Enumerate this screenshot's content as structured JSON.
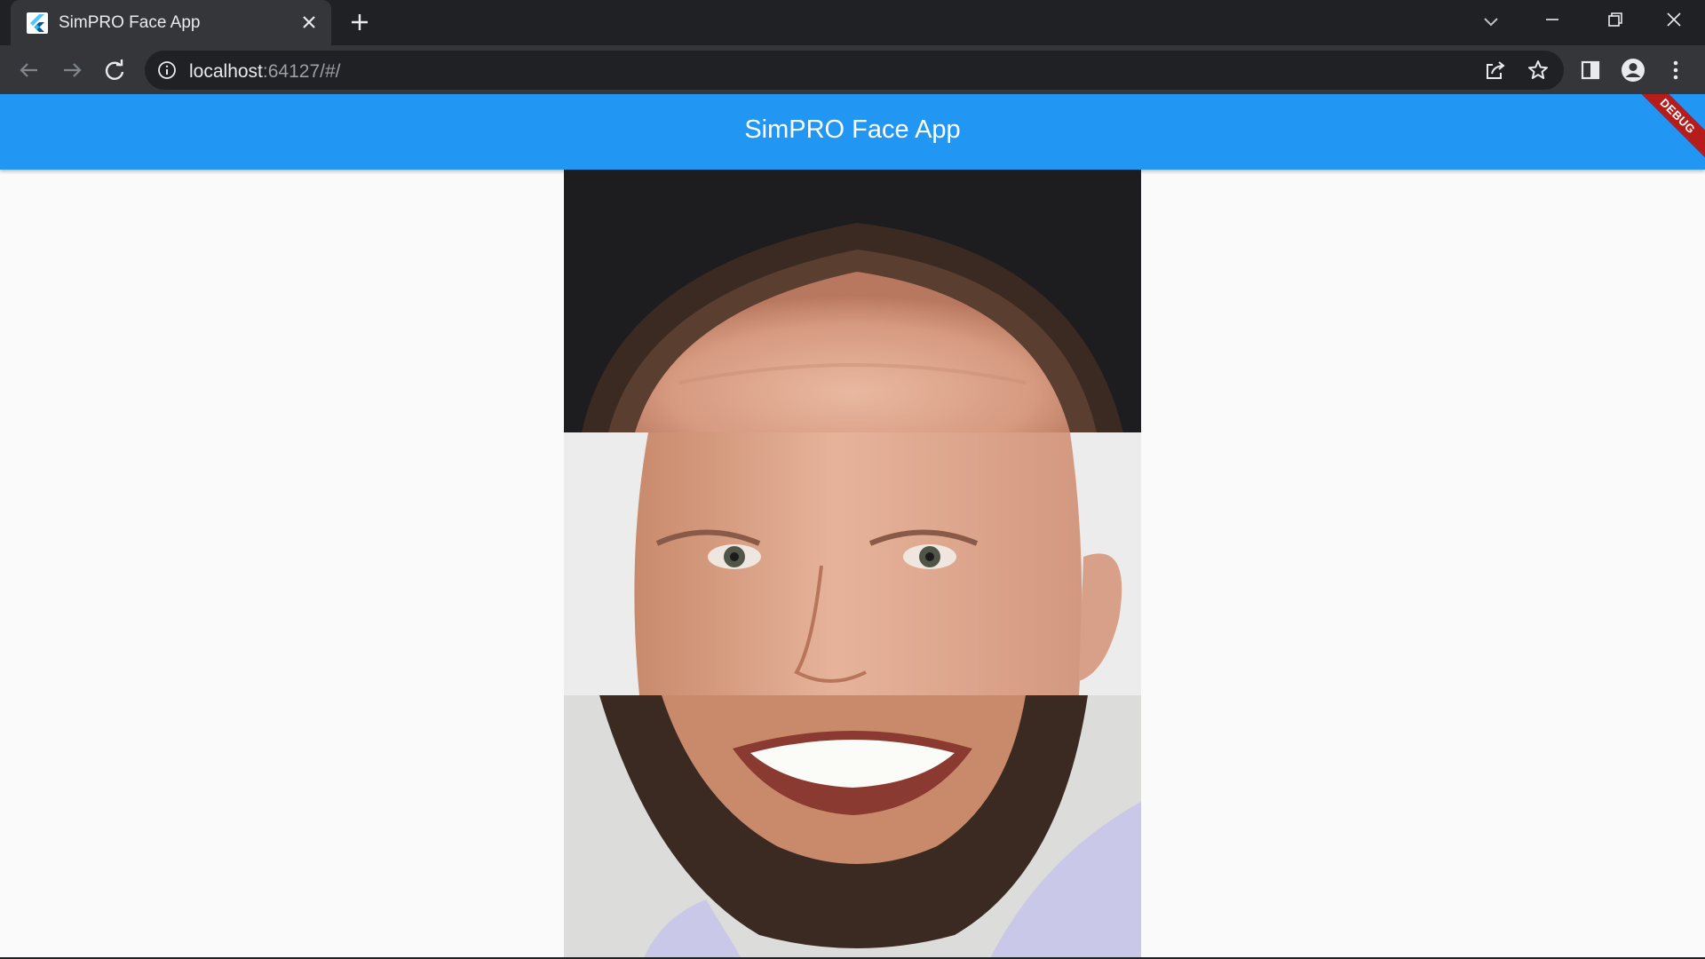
{
  "browser": {
    "tab_title": "SimPRO Face App",
    "url_host": "localhost",
    "url_rest": ":64127/#/"
  },
  "app": {
    "title": "SimPRO Face App",
    "debug_banner": "DEBUG"
  },
  "face_parts": [
    {
      "name": "top-face-image",
      "region": "forehead"
    },
    {
      "name": "middle-face-image",
      "region": "eyes-nose"
    },
    {
      "name": "bottom-face-image",
      "region": "mouth-chin"
    }
  ],
  "colors": {
    "app_bar": "#2196f3",
    "debug_banner": "#b71c1c",
    "page_background": "#fafafa",
    "browser_frame": "#202124"
  }
}
